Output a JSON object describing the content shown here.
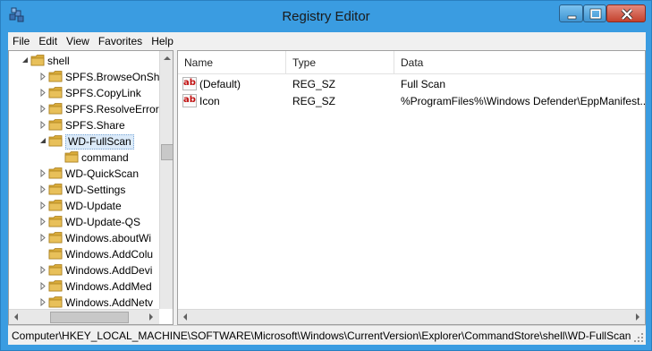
{
  "window": {
    "title": "Registry Editor"
  },
  "menu": [
    "File",
    "Edit",
    "View",
    "Favorites",
    "Help"
  ],
  "tree": {
    "items": [
      {
        "label": "shell",
        "level": 0,
        "expander": "expanded"
      },
      {
        "label": "SPFS.BrowseOnSha",
        "level": 1,
        "expander": "collapsed"
      },
      {
        "label": "SPFS.CopyLink",
        "level": 1,
        "expander": "collapsed"
      },
      {
        "label": "SPFS.ResolveError",
        "level": 1,
        "expander": "collapsed"
      },
      {
        "label": "SPFS.Share",
        "level": 1,
        "expander": "collapsed"
      },
      {
        "label": "WD-FullScan",
        "level": 1,
        "expander": "expanded",
        "selected": true
      },
      {
        "label": "command",
        "level": 2,
        "expander": "none"
      },
      {
        "label": "WD-QuickScan",
        "level": 1,
        "expander": "collapsed"
      },
      {
        "label": "WD-Settings",
        "level": 1,
        "expander": "collapsed"
      },
      {
        "label": "WD-Update",
        "level": 1,
        "expander": "collapsed"
      },
      {
        "label": "WD-Update-QS",
        "level": 1,
        "expander": "collapsed"
      },
      {
        "label": "Windows.aboutWi",
        "level": 1,
        "expander": "collapsed"
      },
      {
        "label": "Windows.AddColu",
        "level": 1,
        "expander": "none"
      },
      {
        "label": "Windows.AddDevi",
        "level": 1,
        "expander": "collapsed"
      },
      {
        "label": "Windows.AddMed",
        "level": 1,
        "expander": "collapsed"
      },
      {
        "label": "Windows.AddNetv",
        "level": 1,
        "expander": "collapsed"
      }
    ]
  },
  "list": {
    "columns": [
      "Name",
      "Type",
      "Data"
    ],
    "rows": [
      {
        "icon": "ab",
        "name": "(Default)",
        "type": "REG_SZ",
        "data": "Full Scan"
      },
      {
        "icon": "ab",
        "name": "Icon",
        "type": "REG_SZ",
        "data": "%ProgramFiles%\\Windows Defender\\EppManifest..."
      }
    ]
  },
  "status": {
    "path": "Computer\\HKEY_LOCAL_MACHINE\\SOFTWARE\\Microsoft\\Windows\\CurrentVersion\\Explorer\\CommandStore\\shell\\WD-FullScan"
  },
  "icons": {
    "app": "registry-editor-icon",
    "folder": "folder-icon",
    "string-value": "string-value-icon"
  },
  "colors": {
    "titlebar": "#3a9ce1",
    "close_button": "#c4422e",
    "folder": "#e8c05a"
  }
}
